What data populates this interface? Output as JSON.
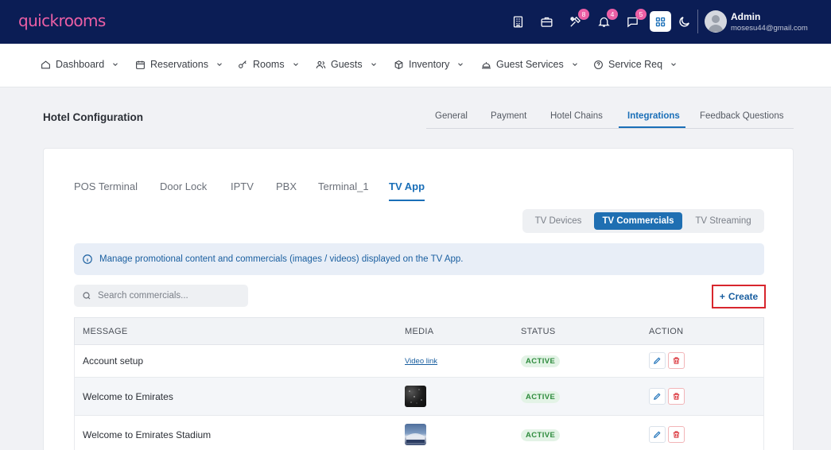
{
  "app": {
    "logo": "quickrooms"
  },
  "header": {
    "badges": {
      "tools": "8",
      "notifications": "4",
      "messages": "5"
    },
    "user": {
      "name": "Admin",
      "email": "mosesu44@gmail.com"
    }
  },
  "nav": {
    "items": [
      {
        "label": "Dashboard"
      },
      {
        "label": "Reservations"
      },
      {
        "label": "Rooms"
      },
      {
        "label": "Guests"
      },
      {
        "label": "Inventory"
      },
      {
        "label": "Guest Services"
      },
      {
        "label": "Service Req"
      }
    ]
  },
  "page": {
    "title": "Hotel Configuration",
    "tabs": [
      "General",
      "Payment",
      "Hotel Chains",
      "Integrations",
      "Feedback Questions"
    ],
    "active_tab": "Integrations"
  },
  "integrations": {
    "tabs": [
      "POS Terminal",
      "Door Lock",
      "IPTV",
      "PBX",
      "Terminal_1",
      "TV App"
    ],
    "active_tab": "TV App"
  },
  "tvapp": {
    "segments": [
      "TV Devices",
      "TV Commercials",
      "TV Streaming"
    ],
    "active_segment": "TV Commercials",
    "info": "Manage promotional content and commercials (images / videos) displayed on the TV App.",
    "search_placeholder": "Search commercials...",
    "create_label": "Create",
    "columns": [
      "MESSAGE",
      "MEDIA",
      "STATUS",
      "ACTION"
    ],
    "rows": [
      {
        "message": "Account setup",
        "media": "Video link",
        "status": "ACTIVE"
      },
      {
        "message": "Welcome to Emirates",
        "media": "image",
        "status": "ACTIVE"
      },
      {
        "message": "Welcome to Emirates Stadium",
        "media": "image",
        "status": "ACTIVE"
      }
    ]
  },
  "colors": {
    "topbar": "#0b1d55",
    "brand": "#ec5fa5",
    "accent": "#1a6fb8",
    "danger": "#d8262d",
    "success": "#2e8b3d"
  }
}
